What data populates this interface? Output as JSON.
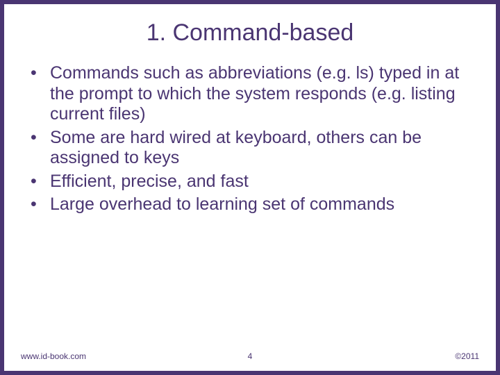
{
  "title": "1. Command-based",
  "bullets": [
    "Commands such as abbreviations (e.g. ls) typed in at the prompt to which the system responds (e.g. listing current files)",
    "Some are hard wired at keyboard, others can be assigned to keys",
    "Efficient, precise, and fast",
    "Large overhead to learning set of commands"
  ],
  "footer": {
    "url": "www.id-book.com",
    "page": "4",
    "copyright": "©2011"
  }
}
